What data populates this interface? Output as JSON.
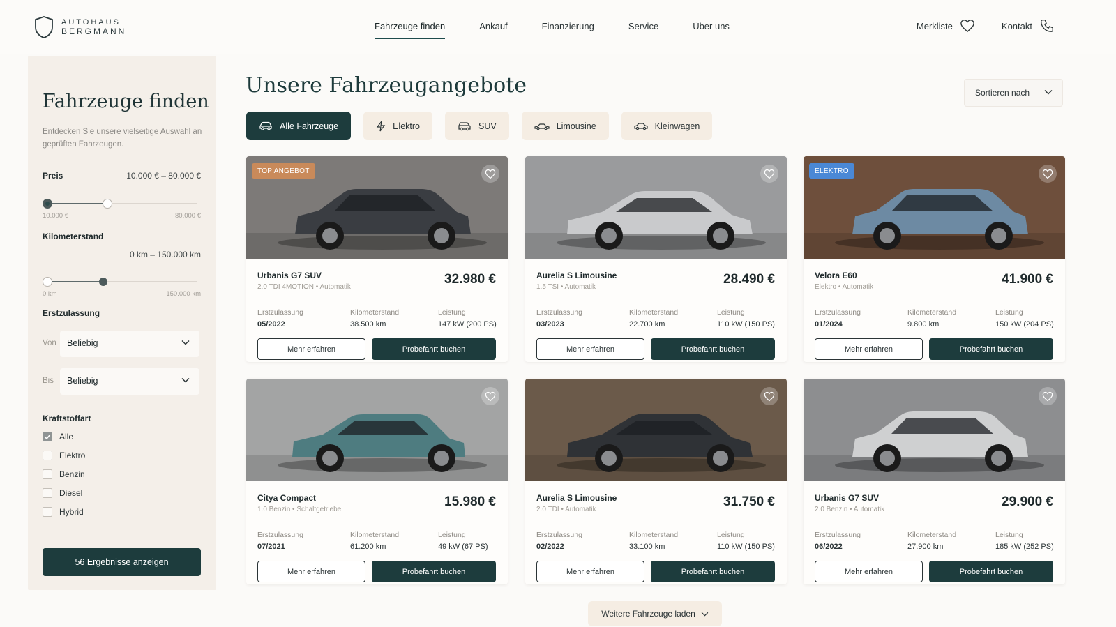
{
  "brand": {
    "line1": "AUTOHAUS",
    "line2": "BERGMANN"
  },
  "nav": [
    {
      "label": "Fahrzeuge finden",
      "active": true
    },
    {
      "label": "Ankauf"
    },
    {
      "label": "Finanzierung"
    },
    {
      "label": "Service"
    },
    {
      "label": "Über uns"
    }
  ],
  "header_right": {
    "wishlist": "Merkliste",
    "contact": "Kontakt"
  },
  "sidebar": {
    "title": "Fahrzeuge finden",
    "description": "Entdecken Sie unsere vielseitige Auswahl an geprüften Fahrzeugen.",
    "price": {
      "label": "Preis",
      "range": "10.000 € – 80.000 €",
      "min_label": "10.000 €",
      "max_label": "80.000 €",
      "low": 0.0,
      "high": 0.4
    },
    "mileage": {
      "label": "Kilometerstand",
      "range": "0 km – 150.000 km",
      "min_label": "0 km",
      "max_label": "150.000 km",
      "low": 0.0,
      "high": 0.4
    },
    "registration": {
      "label": "Erstzulassung",
      "from_prefix": "Von",
      "from_value": "Beliebig",
      "to_prefix": "Bis",
      "to_value": "Beliebig"
    },
    "fuel": {
      "label": "Kraftstoffart",
      "options": [
        {
          "label": "Alle",
          "checked": true
        },
        {
          "label": "Elektro",
          "checked": false
        },
        {
          "label": "Benzin",
          "checked": false
        },
        {
          "label": "Diesel",
          "checked": false
        },
        {
          "label": "Hybrid",
          "checked": false
        }
      ]
    },
    "results_button": "56 Ergebnisse anzeigen"
  },
  "main": {
    "title": "Unsere Fahrzeugangebote",
    "sort_label": "Sortieren nach",
    "filters": [
      {
        "label": "Alle Fahrzeuge",
        "icon": "car-icon",
        "active": true
      },
      {
        "label": "Elektro",
        "icon": "lightning-icon"
      },
      {
        "label": "SUV",
        "icon": "suv-icon"
      },
      {
        "label": "Limousine",
        "icon": "sedan-icon"
      },
      {
        "label": "Kleinwagen",
        "icon": "compact-car-icon"
      }
    ],
    "spec_labels": {
      "reg": "Erstzulassung",
      "km": "Kilometerstand",
      "power": "Leistung"
    },
    "btn_more": "Mehr erfahren",
    "btn_test": "Probefahrt buchen",
    "cars": [
      {
        "name": "Urbanis G7 SUV",
        "sub": "2.0 TDI 4MOTION • Automatik",
        "price": "32.980 €",
        "reg": "05/2022",
        "km": "38.500 km",
        "power": "147 kW (200 PS)",
        "badge": "TOP ANGEBOT",
        "badge_color": "#c98a5a",
        "color": "#3a3d42",
        "bg": "#7d7a78",
        "type": "suv"
      },
      {
        "name": "Aurelia S Limousine",
        "sub": "1.5 TSI • Automatik",
        "price": "28.490 €",
        "reg": "03/2023",
        "km": "22.700 km",
        "power": "110 kW (150 PS)",
        "badge": "",
        "color": "#c9cacc",
        "bg": "#9a9b9d",
        "type": "sedan"
      },
      {
        "name": "Velora E60",
        "sub": "Elektro • Automatik",
        "price": "41.900 €",
        "reg": "01/2024",
        "km": "9.800 km",
        "power": "150 kW (204 PS)",
        "badge": "ELEKTRO",
        "badge_color": "#4a88d6",
        "color": "#6d8aa3",
        "bg": "#6e4f3c",
        "type": "suv"
      },
      {
        "name": "Citya Compact",
        "sub": "1.0 Benzin • Schaltgetriebe",
        "price": "15.980 €",
        "reg": "07/2021",
        "km": "61.200 km",
        "power": "49 kW (67 PS)",
        "badge": "",
        "color": "#4e7c80",
        "bg": "#a3a4a4",
        "type": "hatch"
      },
      {
        "name": "Aurelia S Limousine",
        "sub": "2.0 TDI • Automatik",
        "price": "31.750 €",
        "reg": "02/2022",
        "km": "33.100 km",
        "power": "110 kW (150 PS)",
        "badge": "",
        "color": "#2f3236",
        "bg": "#6b5a4a",
        "type": "sedan"
      },
      {
        "name": "Urbanis G7 SUV",
        "sub": "2.0 Benzin • Automatik",
        "price": "29.900 €",
        "reg": "06/2022",
        "km": "27.900 km",
        "power": "185 kW (252 PS)",
        "badge": "",
        "color": "#cfd0d1",
        "bg": "#8d8e90",
        "type": "suv"
      }
    ],
    "load_more": "Weitere Fahrzeuge laden"
  }
}
